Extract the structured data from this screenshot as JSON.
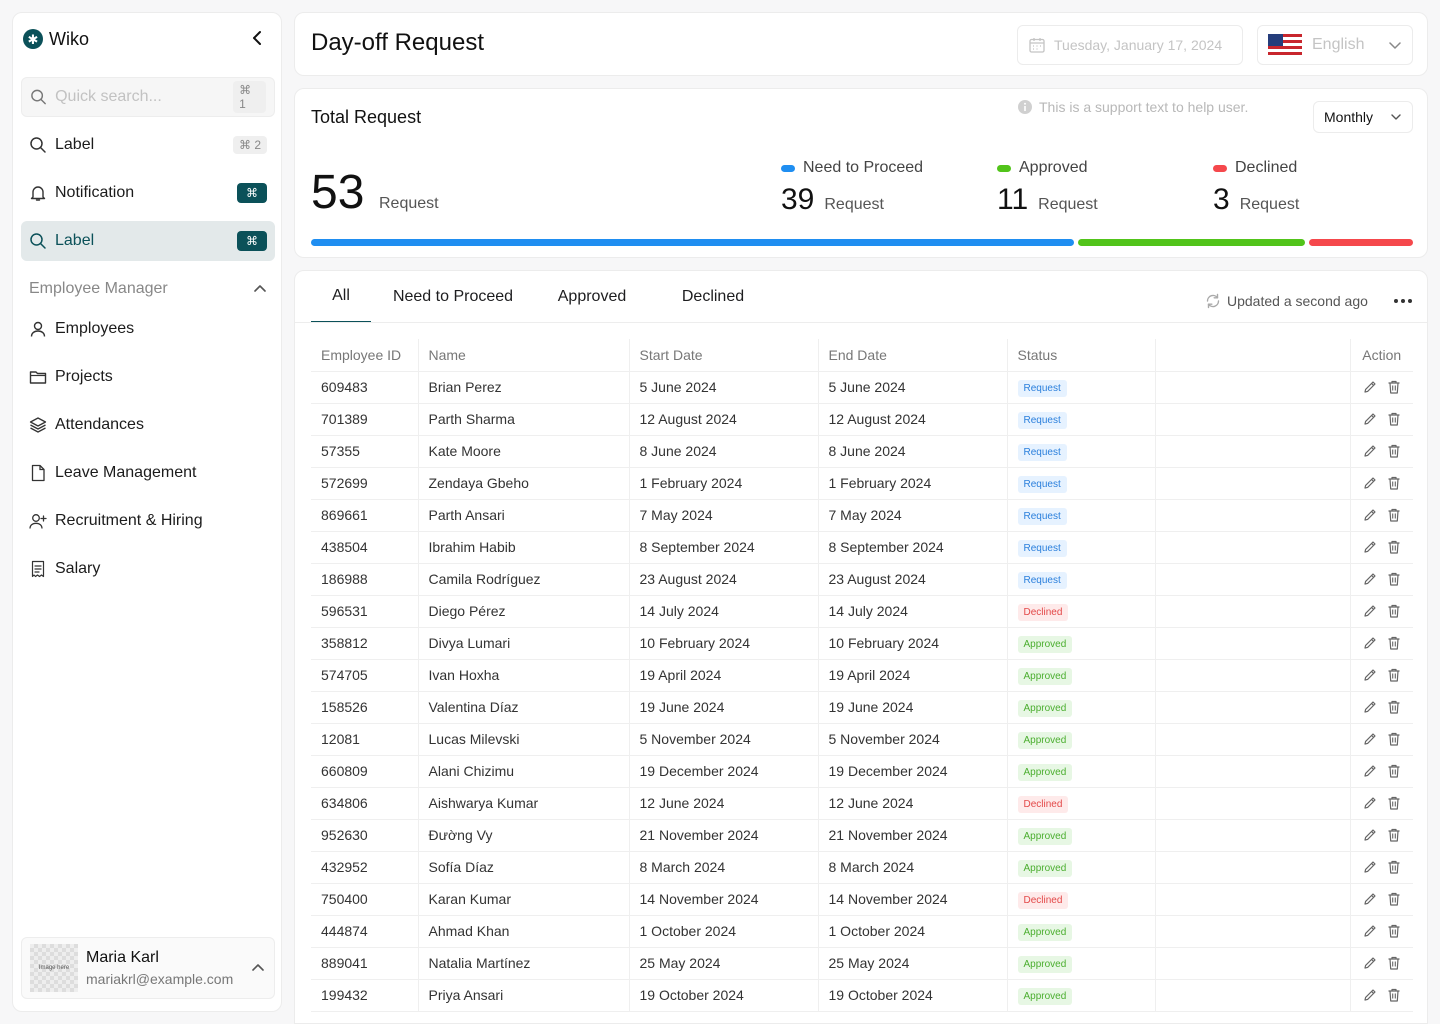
{
  "sidebar": {
    "brand": "Wiko",
    "search": {
      "placeholder": "Quick search...",
      "shortcut": "⌘ 1"
    },
    "top_items": [
      {
        "label": "Label",
        "shortcut": "⌘ 2"
      },
      {
        "label": "Notification",
        "shortcut": "⌘"
      },
      {
        "label": "Label",
        "shortcut": "⌘"
      }
    ],
    "section": "Employee Manager",
    "items": [
      {
        "label": "Employees"
      },
      {
        "label": "Projects"
      },
      {
        "label": "Attendances"
      },
      {
        "label": "Leave Management"
      },
      {
        "label": "Recruitment & Hiring"
      },
      {
        "label": "Salary"
      }
    ],
    "user": {
      "avatar_text": "Image here",
      "name": "Maria Karl",
      "email": "mariakrl@example.com"
    }
  },
  "header": {
    "title": "Day-off Request",
    "date": "Tuesday, January 17, 2024",
    "language": "English"
  },
  "summary": {
    "title": "Total Request",
    "support_text": "This is a support text to help user.",
    "period": "Monthly",
    "total": "53",
    "total_label": "Request",
    "stats": [
      {
        "label": "Need to Proceed",
        "value": "39",
        "unit": "Request",
        "color": "#1f8ef1"
      },
      {
        "label": "Approved",
        "value": "11",
        "unit": "Request",
        "color": "#52c41a"
      },
      {
        "label": "Declined",
        "value": "3",
        "unit": "Request",
        "color": "#f5484c"
      }
    ]
  },
  "tabs": [
    "All",
    "Need to Proceed",
    "Approved",
    "Declined"
  ],
  "updated_text": "Updated a second ago",
  "table": {
    "columns": [
      "Employee ID",
      "Name",
      "Start Date",
      "End Date",
      "Status",
      "",
      "Action"
    ],
    "rows": [
      {
        "id": "609483",
        "name": "Brian Perez",
        "start": "5 June 2024",
        "end": "5 June 2024",
        "status": "Request"
      },
      {
        "id": "701389",
        "name": "Parth Sharma",
        "start": "12 August 2024",
        "end": "12 August 2024",
        "status": "Request"
      },
      {
        "id": "57355",
        "name": "Kate Moore",
        "start": "8 June 2024",
        "end": "8 June 2024",
        "status": "Request"
      },
      {
        "id": "572699",
        "name": "Zendaya Gbeho",
        "start": "1 February 2024",
        "end": "1 February 2024",
        "status": "Request"
      },
      {
        "id": "869661",
        "name": "Parth Ansari",
        "start": "7 May 2024",
        "end": "7 May 2024",
        "status": "Request"
      },
      {
        "id": "438504",
        "name": "Ibrahim Habib",
        "start": "8 September 2024",
        "end": "8 September 2024",
        "status": "Request"
      },
      {
        "id": "186988",
        "name": "Camila Rodríguez",
        "start": "23 August 2024",
        "end": "23 August 2024",
        "status": "Request"
      },
      {
        "id": "596531",
        "name": "Diego Pérez",
        "start": "14 July 2024",
        "end": "14 July 2024",
        "status": "Declined"
      },
      {
        "id": "358812",
        "name": "Divya Lumari",
        "start": "10 February 2024",
        "end": "10 February 2024",
        "status": "Approved"
      },
      {
        "id": "574705",
        "name": "Ivan Hoxha",
        "start": "19 April 2024",
        "end": "19 April 2024",
        "status": "Approved"
      },
      {
        "id": "158526",
        "name": "Valentina Díaz",
        "start": "19 June 2024",
        "end": "19 June 2024",
        "status": "Approved"
      },
      {
        "id": "12081",
        "name": "Lucas Milevski",
        "start": "5 November 2024",
        "end": "5 November 2024",
        "status": "Approved"
      },
      {
        "id": "660809",
        "name": "Alani Chizimu",
        "start": "19 December 2024",
        "end": "19 December 2024",
        "status": "Approved"
      },
      {
        "id": "634806",
        "name": "Aishwarya Kumar",
        "start": "12 June 2024",
        "end": "12 June 2024",
        "status": "Declined"
      },
      {
        "id": "952630",
        "name": "Đường Vy",
        "start": "21 November 2024",
        "end": "21 November 2024",
        "status": "Approved"
      },
      {
        "id": "432952",
        "name": "Sofía Díaz",
        "start": "8 March 2024",
        "end": "8 March 2024",
        "status": "Approved"
      },
      {
        "id": "750400",
        "name": "Karan Kumar",
        "start": "14 November 2024",
        "end": "14 November 2024",
        "status": "Declined"
      },
      {
        "id": "444874",
        "name": "Ahmad Khan",
        "start": "1 October 2024",
        "end": "1 October 2024",
        "status": "Approved"
      },
      {
        "id": "889041",
        "name": "Natalia Martínez",
        "start": "25 May 2024",
        "end": "25 May 2024",
        "status": "Approved"
      },
      {
        "id": "199432",
        "name": "Priya Ansari",
        "start": "19 October 2024",
        "end": "19 October 2024",
        "status": "Approved"
      }
    ]
  }
}
